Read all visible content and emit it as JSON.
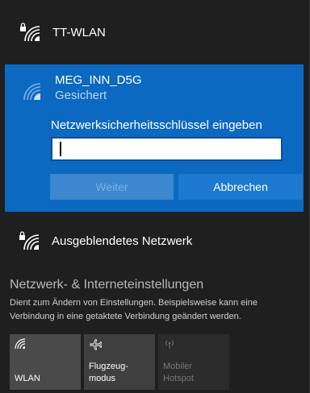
{
  "networks": {
    "top": {
      "ssid": "TT-WLAN"
    },
    "selected": {
      "ssid": "MEG_INN_D5G",
      "security": "Gesichert",
      "key_label": "Netzwerksicherheitsschlüssel eingeben",
      "key_value": "",
      "next_label": "Weiter",
      "cancel_label": "Abbrechen"
    },
    "hidden": {
      "ssid": "Ausgeblendetes Netzwerk"
    }
  },
  "settings": {
    "title": "Netzwerk- & Interneteinstellungen",
    "description": "Dient zum Ändern von Einstellungen. Beispielsweise kann eine Verbindung in eine getaktete Verbindung geändert werden."
  },
  "quick_actions": [
    {
      "label": "WLAN",
      "icon": "wifi-icon",
      "state": "on"
    },
    {
      "label": "Flugzeug-\nmodus",
      "icon": "airplane-icon",
      "state": "off"
    },
    {
      "label": "Mobiler\nHotspot",
      "icon": "hotspot-icon",
      "state": "disabled"
    }
  ],
  "colors": {
    "accent": "#0c69c1",
    "flyout_bg": "#1f1f1f"
  }
}
